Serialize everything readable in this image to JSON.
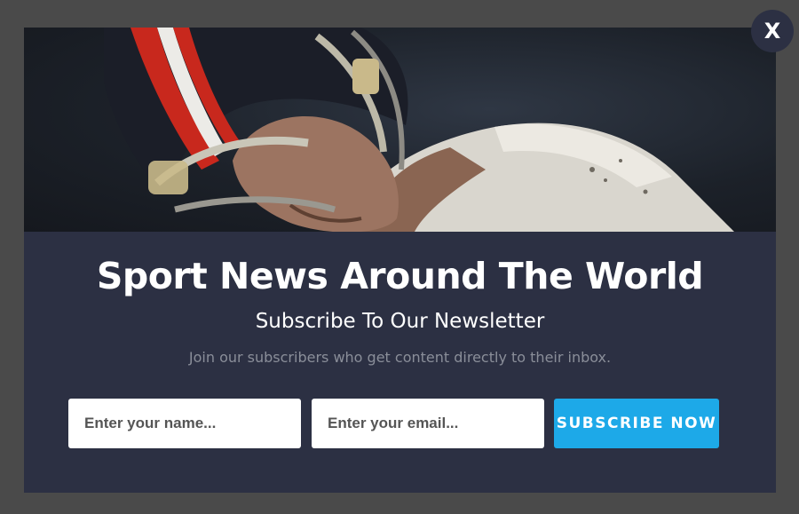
{
  "popup": {
    "hero_image": "football-player-helmet-photo",
    "title": "Sport News Around The World",
    "subtitle": "Subscribe To Our Newsletter",
    "tagline": "Join our subscribers who get content directly to their inbox.",
    "name_placeholder": "Enter your name...",
    "email_placeholder": "Enter your email...",
    "subscribe_label": "SUBSCRIBE NOW",
    "close_label": "X"
  },
  "colors": {
    "overlay": "#4a4a4a",
    "modal_background": "#2c3043",
    "accent_button": "#1da9e8",
    "tagline_text": "#8a8e99"
  },
  "icons": {
    "close": "close-icon"
  }
}
